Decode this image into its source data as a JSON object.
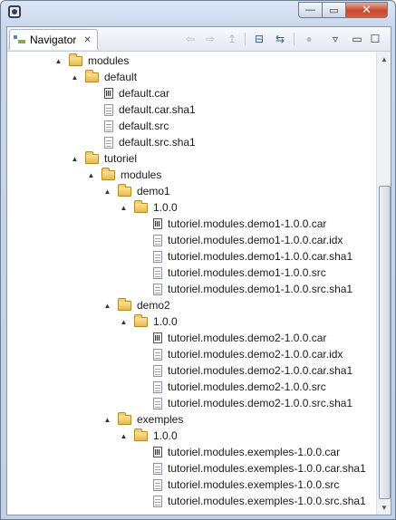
{
  "window": {
    "close_glyph": "✕",
    "max_glyph": "▭",
    "min_glyph": "—"
  },
  "view": {
    "tab_label": "Navigator",
    "tab_close": "✕",
    "toolbar": {
      "back_glyph": "⇦",
      "forward_glyph": "⇨",
      "up_glyph": "↥",
      "collapse_glyph": "⊟",
      "link_glyph": "⇆",
      "menu_glyph": "▿",
      "view_min_glyph": "▭",
      "view_max_glyph": "☐"
    }
  },
  "tree": [
    {
      "label": "modules",
      "icon": "folder",
      "twisty": "▲"
    },
    {
      "label": "default",
      "icon": "folder",
      "twisty": "▲"
    },
    {
      "label": "default.car",
      "icon": "car-file"
    },
    {
      "label": "default.car.sha1",
      "icon": "text-file"
    },
    {
      "label": "default.src",
      "icon": "text-file"
    },
    {
      "label": "default.src.sha1",
      "icon": "text-file"
    },
    {
      "label": "tutoriel",
      "icon": "folder",
      "twisty": "▲"
    },
    {
      "label": "modules",
      "icon": "folder",
      "twisty": "▲"
    },
    {
      "label": "demo1",
      "icon": "folder",
      "twisty": "▲"
    },
    {
      "label": "1.0.0",
      "icon": "folder",
      "twisty": "▲"
    },
    {
      "label": "tutoriel.modules.demo1-1.0.0.car",
      "icon": "car-file"
    },
    {
      "label": "tutoriel.modules.demo1-1.0.0.car.idx",
      "icon": "text-file"
    },
    {
      "label": "tutoriel.modules.demo1-1.0.0.car.sha1",
      "icon": "text-file"
    },
    {
      "label": "tutoriel.modules.demo1-1.0.0.src",
      "icon": "text-file"
    },
    {
      "label": "tutoriel.modules.demo1-1.0.0.src.sha1",
      "icon": "text-file"
    },
    {
      "label": "demo2",
      "icon": "folder",
      "twisty": "▲"
    },
    {
      "label": "1.0.0",
      "icon": "folder",
      "twisty": "▲"
    },
    {
      "label": "tutoriel.modules.demo2-1.0.0.car",
      "icon": "car-file"
    },
    {
      "label": "tutoriel.modules.demo2-1.0.0.car.idx",
      "icon": "text-file"
    },
    {
      "label": "tutoriel.modules.demo2-1.0.0.car.sha1",
      "icon": "text-file"
    },
    {
      "label": "tutoriel.modules.demo2-1.0.0.src",
      "icon": "text-file"
    },
    {
      "label": "tutoriel.modules.demo2-1.0.0.src.sha1",
      "icon": "text-file"
    },
    {
      "label": "exemples",
      "icon": "folder",
      "twisty": "▲"
    },
    {
      "label": "1.0.0",
      "icon": "folder",
      "twisty": "▲"
    },
    {
      "label": "tutoriel.modules.exemples-1.0.0.car",
      "icon": "car-file"
    },
    {
      "label": "tutoriel.modules.exemples-1.0.0.car.sha1",
      "icon": "text-file"
    },
    {
      "label": "tutoriel.modules.exemples-1.0.0.src",
      "icon": "text-file"
    },
    {
      "label": "tutoriel.modules.exemples-1.0.0.src.sha1",
      "icon": "text-file"
    }
  ],
  "scrollbar": {
    "up_glyph": "▲",
    "down_glyph": "▼"
  }
}
